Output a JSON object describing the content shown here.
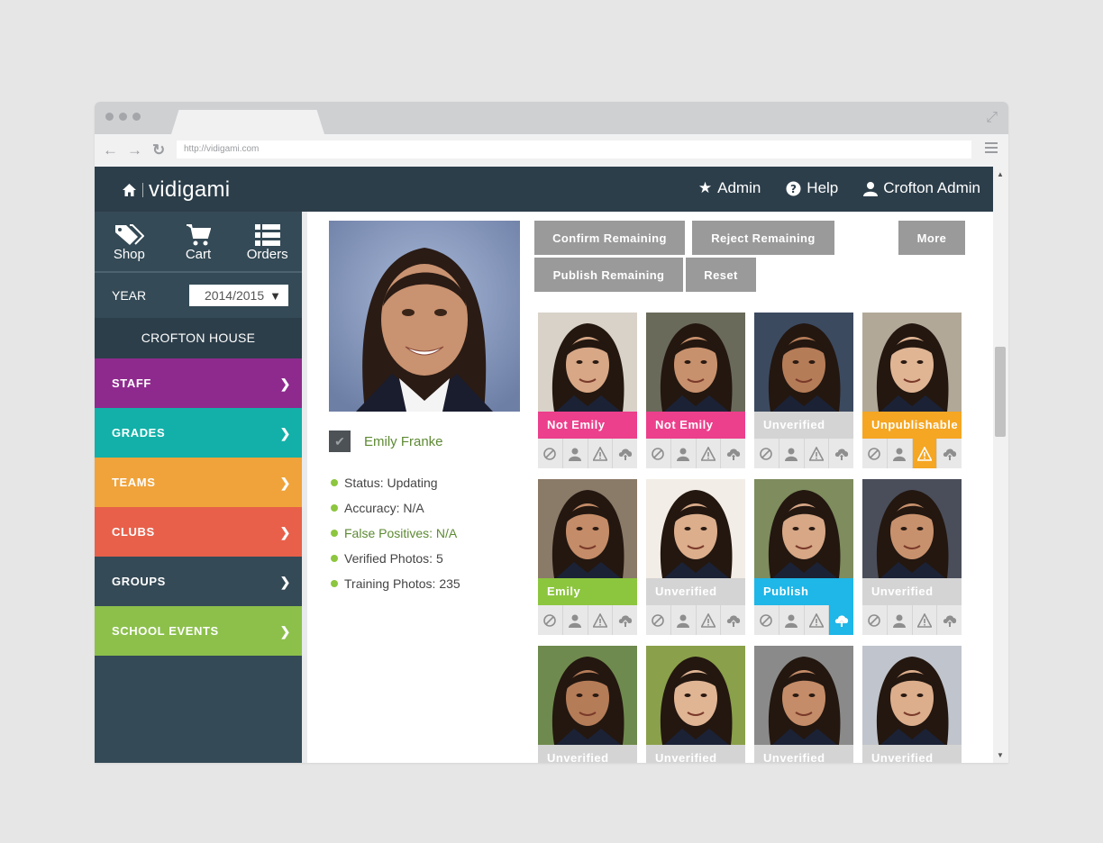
{
  "browser": {
    "url": "http://vidigami.com"
  },
  "header": {
    "brand": "vidigami",
    "nav": [
      {
        "label": "Admin",
        "icon": "star-icon"
      },
      {
        "label": "Help",
        "icon": "help-icon"
      },
      {
        "label": "Crofton Admin",
        "icon": "user-icon"
      }
    ]
  },
  "sidebar": {
    "quick": [
      {
        "label": "Shop",
        "icon": "tag-icon"
      },
      {
        "label": "Cart",
        "icon": "cart-icon"
      },
      {
        "label": "Orders",
        "icon": "list-icon"
      }
    ],
    "year_label": "YEAR",
    "year_value": "2014/2015",
    "school": "CROFTON HOUSE",
    "categories": [
      {
        "label": "STAFF",
        "color": "#8e2a8e"
      },
      {
        "label": "GRADES",
        "color": "#12b0a8"
      },
      {
        "label": "TEAMS",
        "color": "#f0a33a"
      },
      {
        "label": "CLUBS",
        "color": "#e8604a"
      },
      {
        "label": "GROUPS",
        "color": "#344a56"
      },
      {
        "label": "SCHOOL EVENTS",
        "color": "#8cc04b"
      }
    ]
  },
  "person": {
    "name": "Emily Franke",
    "stats": [
      "Status: Updating",
      "Accuracy: N/A",
      "False Positives: N/A",
      "Verified Photos: 5",
      "Training Photos: 235"
    ]
  },
  "actions": {
    "confirm": "Confirm Remaining",
    "reject": "Reject Remaining",
    "more": "More",
    "publish": "Publish Remaining",
    "reset": "Reset"
  },
  "status_colors": {
    "not_emily": "#ec3f8c",
    "unverified": "#d4d4d4",
    "unpublishable": "#f5a623",
    "emily": "#8cc63f",
    "publish": "#1fb6e8"
  },
  "photos": [
    {
      "status": "Not Emily",
      "color": "#ec3f8c",
      "active": -1
    },
    {
      "status": "Not Emily",
      "color": "#ec3f8c",
      "active": -1
    },
    {
      "status": "Unverified",
      "color": "#d4d4d4",
      "active": -1
    },
    {
      "status": "Unpublishable",
      "color": "#f5a623",
      "active": 2
    },
    {
      "status": "Emily",
      "color": "#8cc63f",
      "active": -1
    },
    {
      "status": "Unverified",
      "color": "#d4d4d4",
      "active": -1
    },
    {
      "status": "Publish",
      "color": "#1fb6e8",
      "active": 3
    },
    {
      "status": "Unverified",
      "color": "#d4d4d4",
      "active": -1
    },
    {
      "status": "Unverified",
      "color": "#d4d4d4",
      "active": -1
    },
    {
      "status": "Unverified",
      "color": "#d4d4d4",
      "active": -1
    },
    {
      "status": "Unverified",
      "color": "#d4d4d4",
      "active": -1
    },
    {
      "status": "Unverified",
      "color": "#d4d4d4",
      "active": -1
    }
  ]
}
